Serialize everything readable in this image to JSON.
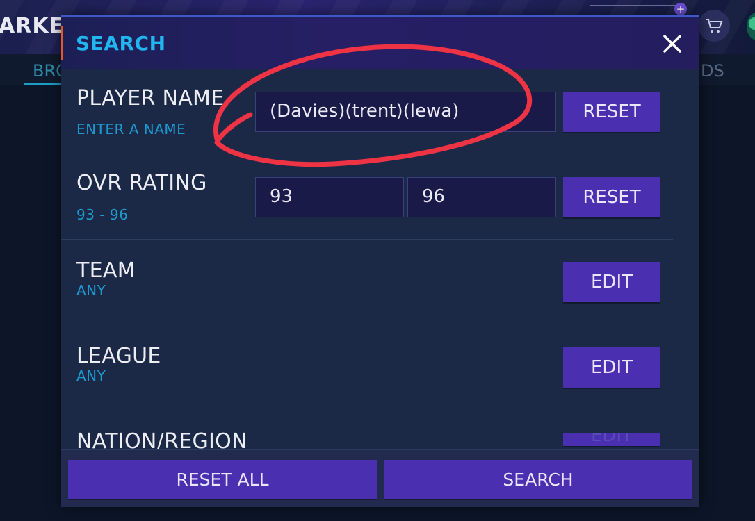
{
  "background": {
    "page_title": "ARKE",
    "tab_left": "BRO",
    "tab_right": "DS"
  },
  "modal": {
    "title": "SEARCH",
    "close_icon": "close-icon"
  },
  "filters": {
    "player_name": {
      "label": "PLAYER NAME",
      "hint": "ENTER A NAME",
      "value": "(Davies)(trent)(lewa)",
      "reset_label": "RESET"
    },
    "ovr_rating": {
      "label": "OVR RATING",
      "range_text": "93 - 96",
      "min_value": "93",
      "max_value": "96",
      "reset_label": "RESET"
    },
    "team": {
      "label": "TEAM",
      "value": "ANY",
      "edit_label": "EDIT"
    },
    "league": {
      "label": "LEAGUE",
      "value": "ANY",
      "edit_label": "EDIT"
    },
    "nation": {
      "label": "NATION/REGION",
      "edit_label": "EDIT"
    }
  },
  "footer": {
    "reset_all_label": "RESET ALL",
    "search_label": "SEARCH"
  },
  "colors": {
    "accent_blue": "#21b6f0",
    "button_purple": "#4a2fb0",
    "annotation_red": "#ee3344"
  }
}
